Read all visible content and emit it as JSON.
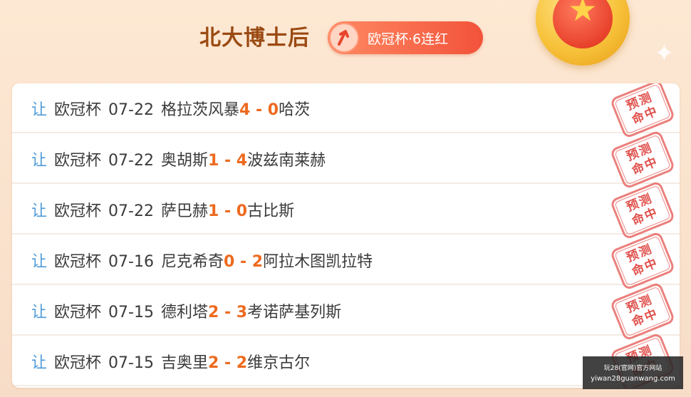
{
  "header": {
    "title": "北大博士后",
    "badge_label": "欧冠杯·6连红",
    "badge_icon": "up-arrow-icon"
  },
  "colors": {
    "title": "#9a4a12",
    "badge_bg": "#f2533a",
    "handicap": "#4d9ad9",
    "score": "#ee6a1f",
    "stamp": "#e0504c"
  },
  "stamp": {
    "line1": "预测",
    "line2": "命中"
  },
  "predictions": [
    {
      "tag": "让",
      "league": "欧冠杯",
      "date": "07-22",
      "home": "格拉茨风暴",
      "home_score": "4",
      "sep": " - ",
      "away_score": "0",
      "away": "哈茨"
    },
    {
      "tag": "让",
      "league": "欧冠杯",
      "date": "07-22",
      "home": "奥胡斯",
      "home_score": "1",
      "sep": " - ",
      "away_score": "4",
      "away": "波兹南莱赫"
    },
    {
      "tag": "让",
      "league": "欧冠杯",
      "date": "07-22",
      "home": "萨巴赫",
      "home_score": "1",
      "sep": " - ",
      "away_score": "0",
      "away": "古比斯"
    },
    {
      "tag": "让",
      "league": "欧冠杯",
      "date": "07-16",
      "home": "尼克希奇",
      "home_score": "0",
      "sep": " - ",
      "away_score": "2",
      "away": "阿拉木图凯拉特"
    },
    {
      "tag": "让",
      "league": "欧冠杯",
      "date": "07-15",
      "home": "德利塔",
      "home_score": "2",
      "sep": " - ",
      "away_score": "3",
      "away": "考诺萨基列斯"
    },
    {
      "tag": "让",
      "league": "欧冠杯",
      "date": "07-15",
      "home": "吉奥里",
      "home_score": "2",
      "sep": " - ",
      "away_score": "2",
      "away": "维京古尔"
    }
  ],
  "watermark": {
    "line1": "玩28(官网)官方网站",
    "line2": "yiwan28guanwang.com"
  }
}
